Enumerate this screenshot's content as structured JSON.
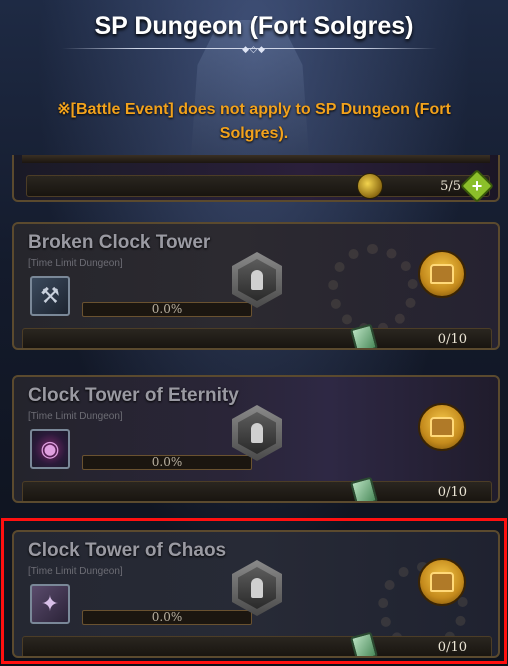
{
  "header": {
    "title": "SP Dungeon (Fort Solgres)",
    "notice": "※[Battle Event] does not apply to SP Dungeon (Fort Solgres)."
  },
  "top_card": {
    "count": "5/5",
    "add_label": "+"
  },
  "dungeons": [
    {
      "name": "Broken Clock Tower",
      "type_label": "[Time Limit Dungeon]",
      "progress_text": "0.0%",
      "progress": 0.0,
      "count": "0/10"
    },
    {
      "name": "Clock Tower of Eternity",
      "type_label": "[Time Limit Dungeon]",
      "progress_text": "0.0%",
      "progress": 0.0,
      "count": "0/10"
    },
    {
      "name": "Clock Tower of Chaos",
      "type_label": "[Time Limit Dungeon]",
      "progress_text": "0.0%",
      "progress": 0.0,
      "count": "0/10"
    }
  ],
  "colors": {
    "notice": "#f2a21c",
    "frame": "#5b4a2e",
    "selection": "#ff1010"
  }
}
